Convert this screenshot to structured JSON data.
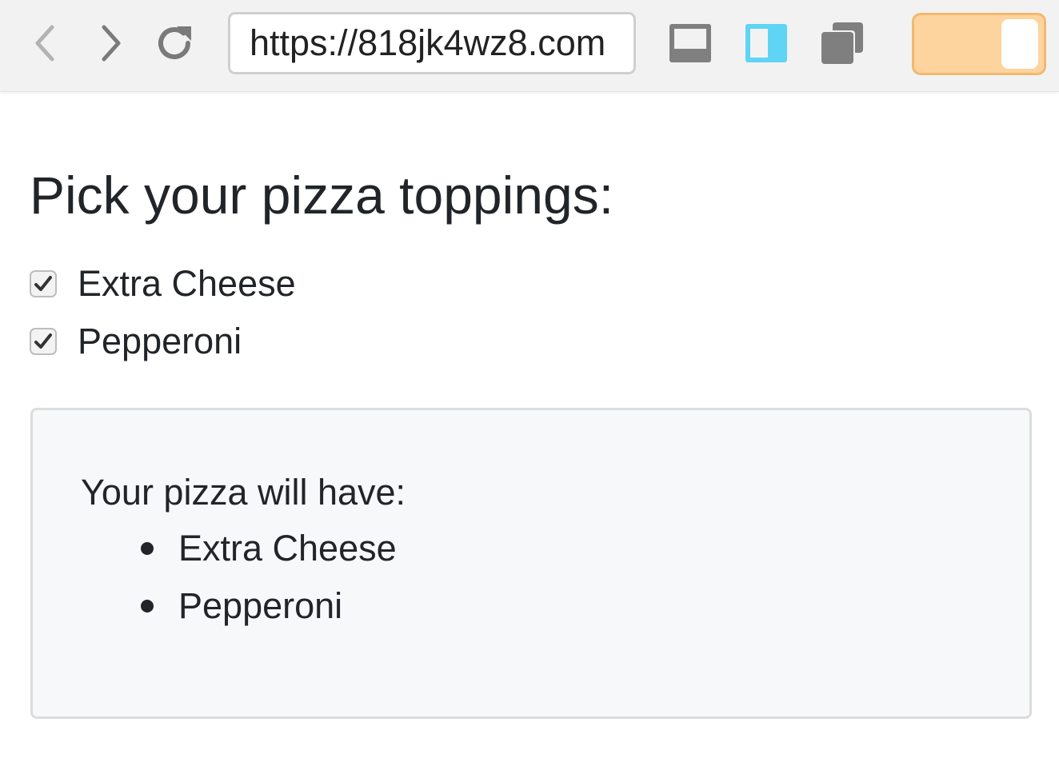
{
  "browser": {
    "url": "https://818jk4wz8.com",
    "icons": {
      "back": "chevron-left-icon",
      "forward": "chevron-right-icon",
      "reload": "reload-icon",
      "layout_bottom": "panel-bottom-icon",
      "layout_side": "panel-side-icon",
      "layout_windows": "windows-stack-icon"
    },
    "colors": {
      "toolbar": "#f2f2f2",
      "side_panel_active": "#5fd4f5",
      "toggle_track": "#fdd49e",
      "toggle_border": "#f2b870"
    },
    "toggle_on": true
  },
  "page": {
    "title": "Pick your pizza toppings:",
    "toppings": [
      {
        "label": "Extra Cheese",
        "checked": true
      },
      {
        "label": "Pepperoni",
        "checked": true
      }
    ],
    "summary": {
      "heading": "Your pizza will have:",
      "items": [
        "Extra Cheese",
        "Pepperoni"
      ]
    }
  }
}
